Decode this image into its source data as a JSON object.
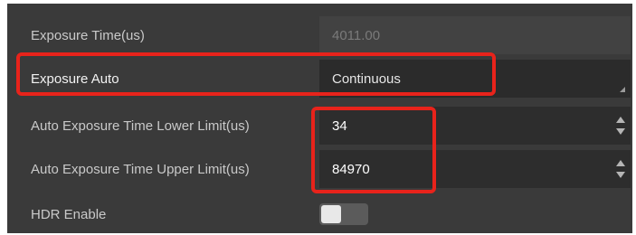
{
  "properties": [
    {
      "label": "Exposure Time(us)",
      "value": "4011.00",
      "control": "readonly"
    },
    {
      "label": "Exposure Auto",
      "value": "Continuous",
      "control": "dropdown"
    },
    {
      "label": "Auto Exposure Time Lower Limit(us)",
      "value": "34",
      "control": "spinbox"
    },
    {
      "label": "Auto Exposure Time Upper Limit(us)",
      "value": "84970",
      "control": "spinbox"
    },
    {
      "label": "HDR Enable",
      "value": false,
      "control": "toggle"
    }
  ],
  "colors": {
    "panel_background": "#3a3a3a",
    "highlight": "#e8231b",
    "toggle_knob": "#e8e8e8"
  },
  "icons": {
    "dropdown": "dropdown-corner-icon",
    "spinbox": "spin-arrows-icon"
  }
}
